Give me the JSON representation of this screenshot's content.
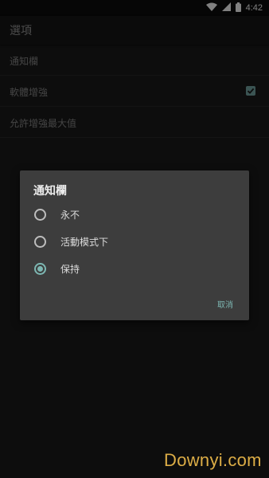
{
  "status_bar": {
    "time": "4:42",
    "icons": [
      "wifi-icon",
      "signal-icon",
      "battery-icon"
    ]
  },
  "app_bar": {
    "title": "選項"
  },
  "preferences": {
    "items": [
      {
        "label": "通知欄",
        "has_checkbox": false
      },
      {
        "label": "軟體增強",
        "has_checkbox": true,
        "checked": true
      },
      {
        "label": "允許增強最大值",
        "has_checkbox": false
      }
    ]
  },
  "dialog": {
    "title": "通知欄",
    "options": [
      {
        "label": "永不",
        "selected": false
      },
      {
        "label": "活動模式下",
        "selected": false
      },
      {
        "label": "保持",
        "selected": true
      }
    ],
    "cancel_label": "取消"
  },
  "watermark": {
    "text": "Downyi.com"
  },
  "colors": {
    "accent": "#7db7b2",
    "dialog_bg": "#3d3d3d",
    "background": "#181818",
    "watermark": "#e8b64a"
  }
}
